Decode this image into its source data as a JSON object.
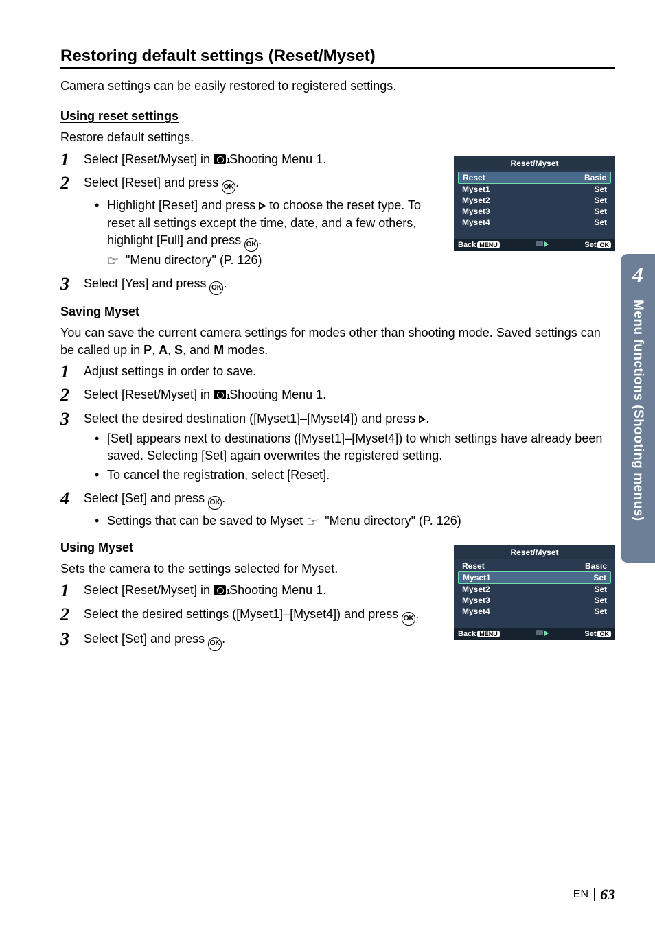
{
  "page": {
    "heading": "Restoring default settings (Reset/Myset)",
    "intro": "Camera settings can be easily restored to registered settings."
  },
  "sidebar": {
    "chapter": "4",
    "label": "Menu functions (Shooting menus)"
  },
  "footer": {
    "lang": "EN",
    "page": "63"
  },
  "s1": {
    "title": "Using reset settings",
    "body": "Restore default settings.",
    "step1a": "Select [Reset/Myset] in ",
    "step1b": " Shooting Menu 1.",
    "step2": "Select [Reset] and press ",
    "step2_dot": ".",
    "step2_sub1a": "Highlight [Reset] and press ",
    "step2_sub1b": " to choose the reset type. To reset all settings except the time, date, and a few others, highlight [Full] and press ",
    "step2_sub1c": ".",
    "step2_sub2": " \"Menu directory\" (P. 126)",
    "step3": "Select [Yes] and press ",
    "step3_dot": "."
  },
  "s2": {
    "title": "Saving Myset",
    "body_a": "You can save the current camera settings for modes other than shooting mode. Saved settings can be called up in ",
    "body_b": " modes.",
    "modes": [
      "P",
      "A",
      "S",
      "M"
    ],
    "sep": ", ",
    "and": ", and ",
    "step1": "Adjust settings in order to save.",
    "step2a": "Select [Reset/Myset] in ",
    "step2b": " Shooting Menu 1.",
    "step3a": "Select the desired destination ([Myset1]–[Myset4]) and press ",
    "step3b": ".",
    "step3_sub1": "[Set] appears next to destinations ([Myset1]–[Myset4]) to which settings have already been saved. Selecting [Set] again overwrites the registered setting.",
    "step3_sub2": "To cancel the registration, select [Reset].",
    "step4a": "Select [Set] and press ",
    "step4b": ".",
    "step4_sub_a": "Settings that can be saved to Myset ",
    "step4_sub_b": " \"Menu directory\" (P. 126)"
  },
  "s3": {
    "title": "Using Myset",
    "body": "Sets the camera to the settings selected for Myset.",
    "step1a": "Select [Reset/Myset] in ",
    "step1b": " Shooting Menu 1.",
    "step2a": "Select the desired settings ([Myset1]–[Myset4]) and press ",
    "step2b": ".",
    "step3a": "Select [Set] and press ",
    "step3b": "."
  },
  "menu": {
    "title": "Reset/Myset",
    "rows": [
      {
        "l": "Reset",
        "r": "Basic"
      },
      {
        "l": "Myset1",
        "r": "Set"
      },
      {
        "l": "Myset2",
        "r": "Set"
      },
      {
        "l": "Myset3",
        "r": "Set"
      },
      {
        "l": "Myset4",
        "r": "Set"
      }
    ],
    "back": "Back",
    "back_pill": "MENU",
    "set": "Set",
    "set_pill": "OK",
    "selected_first": 0,
    "selected_second": 1
  }
}
